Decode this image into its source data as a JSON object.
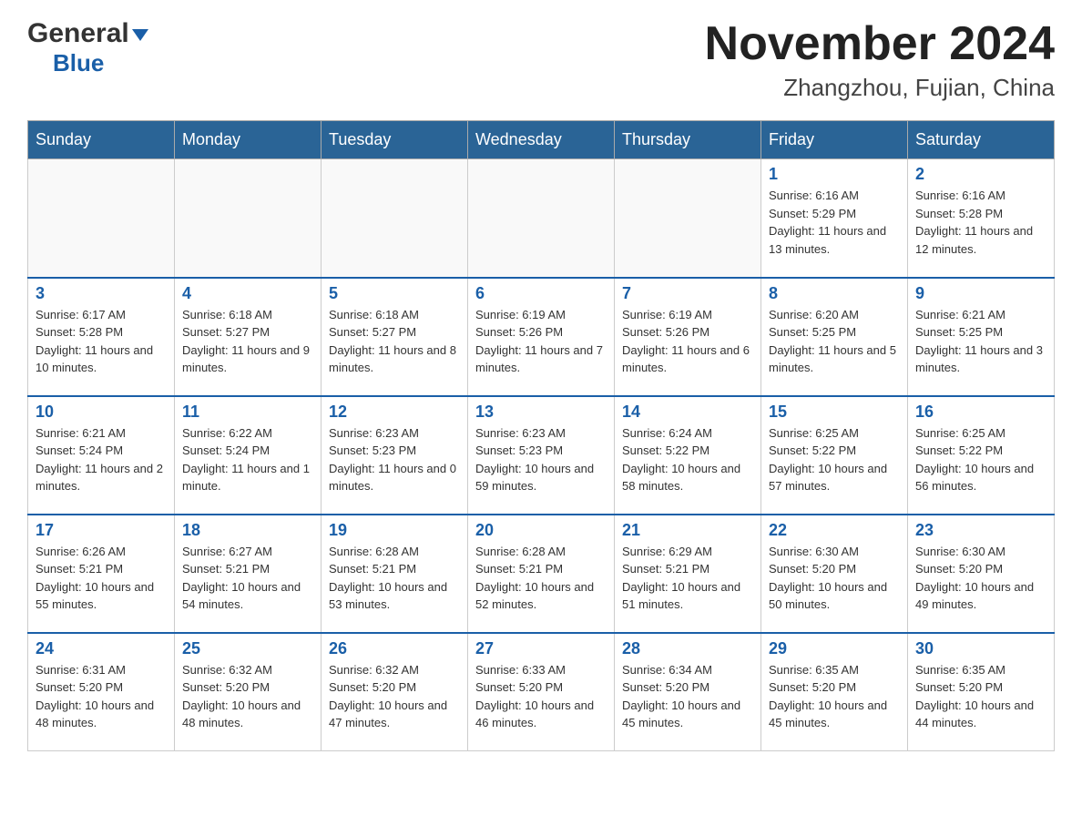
{
  "header": {
    "logo_general": "General",
    "logo_blue": "Blue",
    "month_title": "November 2024",
    "location": "Zhangzhou, Fujian, China"
  },
  "days_of_week": [
    "Sunday",
    "Monday",
    "Tuesday",
    "Wednesday",
    "Thursday",
    "Friday",
    "Saturday"
  ],
  "weeks": [
    [
      {
        "day": "",
        "info": ""
      },
      {
        "day": "",
        "info": ""
      },
      {
        "day": "",
        "info": ""
      },
      {
        "day": "",
        "info": ""
      },
      {
        "day": "",
        "info": ""
      },
      {
        "day": "1",
        "info": "Sunrise: 6:16 AM\nSunset: 5:29 PM\nDaylight: 11 hours and 13 minutes."
      },
      {
        "day": "2",
        "info": "Sunrise: 6:16 AM\nSunset: 5:28 PM\nDaylight: 11 hours and 12 minutes."
      }
    ],
    [
      {
        "day": "3",
        "info": "Sunrise: 6:17 AM\nSunset: 5:28 PM\nDaylight: 11 hours and 10 minutes."
      },
      {
        "day": "4",
        "info": "Sunrise: 6:18 AM\nSunset: 5:27 PM\nDaylight: 11 hours and 9 minutes."
      },
      {
        "day": "5",
        "info": "Sunrise: 6:18 AM\nSunset: 5:27 PM\nDaylight: 11 hours and 8 minutes."
      },
      {
        "day": "6",
        "info": "Sunrise: 6:19 AM\nSunset: 5:26 PM\nDaylight: 11 hours and 7 minutes."
      },
      {
        "day": "7",
        "info": "Sunrise: 6:19 AM\nSunset: 5:26 PM\nDaylight: 11 hours and 6 minutes."
      },
      {
        "day": "8",
        "info": "Sunrise: 6:20 AM\nSunset: 5:25 PM\nDaylight: 11 hours and 5 minutes."
      },
      {
        "day": "9",
        "info": "Sunrise: 6:21 AM\nSunset: 5:25 PM\nDaylight: 11 hours and 3 minutes."
      }
    ],
    [
      {
        "day": "10",
        "info": "Sunrise: 6:21 AM\nSunset: 5:24 PM\nDaylight: 11 hours and 2 minutes."
      },
      {
        "day": "11",
        "info": "Sunrise: 6:22 AM\nSunset: 5:24 PM\nDaylight: 11 hours and 1 minute."
      },
      {
        "day": "12",
        "info": "Sunrise: 6:23 AM\nSunset: 5:23 PM\nDaylight: 11 hours and 0 minutes."
      },
      {
        "day": "13",
        "info": "Sunrise: 6:23 AM\nSunset: 5:23 PM\nDaylight: 10 hours and 59 minutes."
      },
      {
        "day": "14",
        "info": "Sunrise: 6:24 AM\nSunset: 5:22 PM\nDaylight: 10 hours and 58 minutes."
      },
      {
        "day": "15",
        "info": "Sunrise: 6:25 AM\nSunset: 5:22 PM\nDaylight: 10 hours and 57 minutes."
      },
      {
        "day": "16",
        "info": "Sunrise: 6:25 AM\nSunset: 5:22 PM\nDaylight: 10 hours and 56 minutes."
      }
    ],
    [
      {
        "day": "17",
        "info": "Sunrise: 6:26 AM\nSunset: 5:21 PM\nDaylight: 10 hours and 55 minutes."
      },
      {
        "day": "18",
        "info": "Sunrise: 6:27 AM\nSunset: 5:21 PM\nDaylight: 10 hours and 54 minutes."
      },
      {
        "day": "19",
        "info": "Sunrise: 6:28 AM\nSunset: 5:21 PM\nDaylight: 10 hours and 53 minutes."
      },
      {
        "day": "20",
        "info": "Sunrise: 6:28 AM\nSunset: 5:21 PM\nDaylight: 10 hours and 52 minutes."
      },
      {
        "day": "21",
        "info": "Sunrise: 6:29 AM\nSunset: 5:21 PM\nDaylight: 10 hours and 51 minutes."
      },
      {
        "day": "22",
        "info": "Sunrise: 6:30 AM\nSunset: 5:20 PM\nDaylight: 10 hours and 50 minutes."
      },
      {
        "day": "23",
        "info": "Sunrise: 6:30 AM\nSunset: 5:20 PM\nDaylight: 10 hours and 49 minutes."
      }
    ],
    [
      {
        "day": "24",
        "info": "Sunrise: 6:31 AM\nSunset: 5:20 PM\nDaylight: 10 hours and 48 minutes."
      },
      {
        "day": "25",
        "info": "Sunrise: 6:32 AM\nSunset: 5:20 PM\nDaylight: 10 hours and 48 minutes."
      },
      {
        "day": "26",
        "info": "Sunrise: 6:32 AM\nSunset: 5:20 PM\nDaylight: 10 hours and 47 minutes."
      },
      {
        "day": "27",
        "info": "Sunrise: 6:33 AM\nSunset: 5:20 PM\nDaylight: 10 hours and 46 minutes."
      },
      {
        "day": "28",
        "info": "Sunrise: 6:34 AM\nSunset: 5:20 PM\nDaylight: 10 hours and 45 minutes."
      },
      {
        "day": "29",
        "info": "Sunrise: 6:35 AM\nSunset: 5:20 PM\nDaylight: 10 hours and 45 minutes."
      },
      {
        "day": "30",
        "info": "Sunrise: 6:35 AM\nSunset: 5:20 PM\nDaylight: 10 hours and 44 minutes."
      }
    ]
  ]
}
